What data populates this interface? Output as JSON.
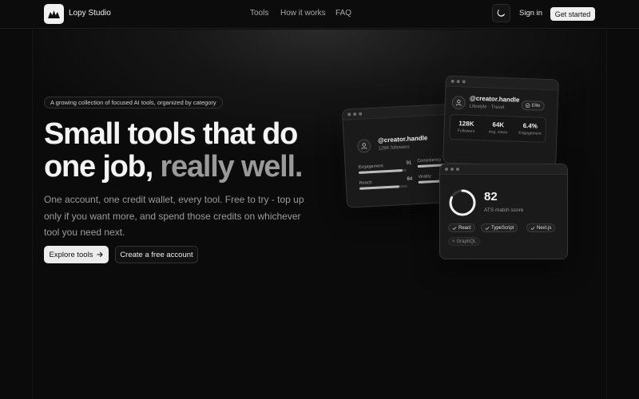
{
  "nav": {
    "brand": "Lopy Studio",
    "links": [
      "Tools",
      "How it works",
      "FAQ"
    ],
    "signin": "Sign in",
    "get_started": "Get started"
  },
  "hero": {
    "pill": "A growing collection of focused AI tools, organized by category",
    "title_line1": "Small tools that do",
    "title_line2_a": "one job,",
    "title_line2_b": "really well.",
    "subtitle": "One account, one credit wallet, every tool. Free to try - top up only if you want more, and spend those credits on whichever tool you need next.",
    "explore_label": "Explore tools",
    "create_label": "Create a free account"
  },
  "card_creator": {
    "handle": "@creator.handle",
    "followers": "128K followers",
    "metrics": [
      {
        "label": "Engagement",
        "value": "91",
        "fill": 0.91
      },
      {
        "label": "Consistency",
        "value": "",
        "fill": 0.7
      },
      {
        "label": "Reach",
        "value": "84",
        "fill": 0.84
      },
      {
        "label": "Virality",
        "value": "",
        "fill": 0.6
      }
    ]
  },
  "card_profile": {
    "handle": "@creator.handle",
    "category": "Lifestyle · Travel",
    "badge": "Elite",
    "stats": [
      {
        "value": "128K",
        "label": "Followers"
      },
      {
        "value": "64K",
        "label": "Avg. views"
      },
      {
        "value": "6.4%",
        "label": "Engagement"
      }
    ]
  },
  "card_ats": {
    "score": "82",
    "score_label": "ATS match score",
    "score_fraction": 0.82,
    "tags": [
      "React",
      "TypeScript",
      "Next.js"
    ],
    "missing_tags": [
      "GraphQL"
    ]
  }
}
